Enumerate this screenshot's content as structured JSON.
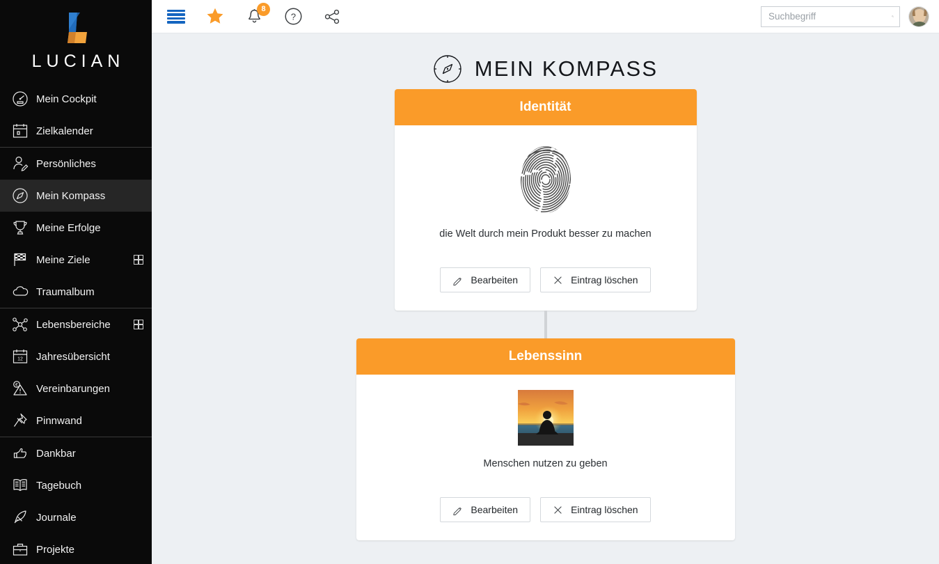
{
  "brand": {
    "name": "LUCIAN",
    "logo_icon": "lucian-logo"
  },
  "sidebar": {
    "items": [
      {
        "label": "Mein Cockpit",
        "icon": "gauge-icon",
        "active": false,
        "expandable": false,
        "sep_after": false
      },
      {
        "label": "Zielkalender",
        "icon": "calendar-icon",
        "active": false,
        "expandable": false,
        "sep_after": true
      },
      {
        "label": "Persönliches",
        "icon": "person-edit-icon",
        "active": false,
        "expandable": false,
        "sep_after": false
      },
      {
        "label": "Mein Kompass",
        "icon": "compass-icon",
        "active": true,
        "expandable": false,
        "sep_after": false
      },
      {
        "label": "Meine Erfolge",
        "icon": "trophy-icon",
        "active": false,
        "expandable": false,
        "sep_after": false
      },
      {
        "label": "Meine Ziele",
        "icon": "checkered-flag-icon",
        "active": false,
        "expandable": true,
        "sep_after": false
      },
      {
        "label": "Traumalbum",
        "icon": "cloud-icon",
        "active": false,
        "expandable": false,
        "sep_after": true
      },
      {
        "label": "Lebensbereiche",
        "icon": "network-icon",
        "active": false,
        "expandable": true,
        "sep_after": false
      },
      {
        "label": "Jahresübersicht",
        "icon": "calendar-12-icon",
        "active": false,
        "expandable": false,
        "sep_after": false
      },
      {
        "label": "Vereinbarungen",
        "icon": "euro-warning-icon",
        "active": false,
        "expandable": false,
        "sep_after": false
      },
      {
        "label": "Pinnwand",
        "icon": "pushpin-icon",
        "active": false,
        "expandable": false,
        "sep_after": true
      },
      {
        "label": "Dankbar",
        "icon": "thumbs-up-icon",
        "active": false,
        "expandable": false,
        "sep_after": false
      },
      {
        "label": "Tagebuch",
        "icon": "open-book-icon",
        "active": false,
        "expandable": false,
        "sep_after": false
      },
      {
        "label": "Journale",
        "icon": "quill-icon",
        "active": false,
        "expandable": false,
        "sep_after": false
      },
      {
        "label": "Projekte",
        "icon": "briefcase-icon",
        "active": false,
        "expandable": false,
        "sep_after": false
      }
    ]
  },
  "topbar": {
    "menu_icon": "hamburger-icon",
    "favorites_icon": "star-icon",
    "notifications_icon": "bell-icon",
    "notifications_count": "8",
    "help_icon": "question-circle-icon",
    "share_icon": "share-icon",
    "search": {
      "placeholder": "Suchbegriff",
      "value": "",
      "icon": "search-icon"
    },
    "avatar_name": "user-avatar"
  },
  "page": {
    "title": "MEIN KOMPASS",
    "title_icon": "compass-icon"
  },
  "cards": [
    {
      "title": "Identität",
      "image_name": "fingerprint-image",
      "text": "die Welt durch mein Produkt besser zu machen",
      "edit_label": "Bearbeiten",
      "edit_icon": "pencil-icon",
      "delete_label": "Eintrag löschen",
      "delete_icon": "close-x-icon"
    },
    {
      "title": "Lebenssinn",
      "image_name": "sunset-meditation-image",
      "text": "Menschen nutzen zu geben",
      "edit_label": "Bearbeiten",
      "edit_icon": "pencil-icon",
      "delete_label": "Eintrag löschen",
      "delete_icon": "close-x-icon"
    }
  ],
  "colors": {
    "accent_orange": "#fa9b29",
    "sidebar_bg": "#0a0a0a",
    "sidebar_active": "#262626",
    "content_bg": "#edf0f3",
    "menu_blue": "#1565c0"
  }
}
